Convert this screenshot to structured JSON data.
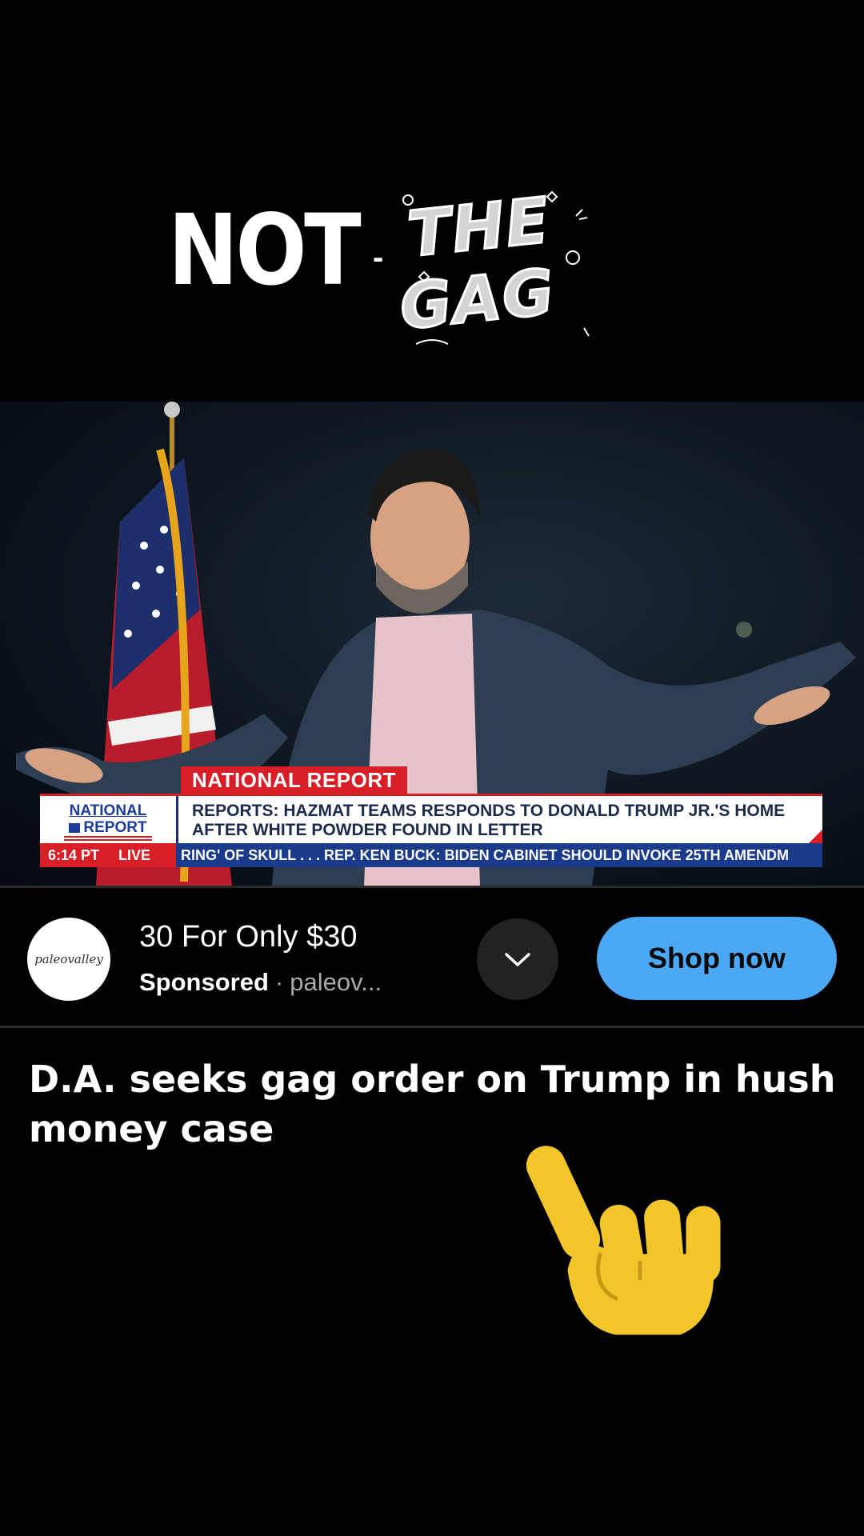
{
  "logo": {
    "word1": "NOT",
    "dash": "-",
    "word2": "THE",
    "word3": "GAG"
  },
  "video": {
    "lower_third": {
      "tab": "NATIONAL REPORT",
      "brand_line1": "NATIONAL",
      "brand_line2": "REPORT",
      "headline": "REPORTS: HAZMAT TEAMS RESPONDS TO DONALD TRUMP JR.'S HOME AFTER WHITE POWDER FOUND IN LETTER",
      "time": "6:14 PT",
      "live": "LIVE",
      "ticker": "RING' OF SKULL . . .      REP. KEN BUCK: BIDEN CABINET SHOULD INVOKE 25TH AMENDM"
    }
  },
  "ad": {
    "avatar_text": "paleovalley",
    "title": "30 For Only $30",
    "sponsored": "Sponsored",
    "separator": "·",
    "domain": "paleov...",
    "cta": "Shop now",
    "chevron_icon": "chevron-down-icon",
    "cta_color": "#4aa8f5"
  },
  "post": {
    "headline": "D.A. seeks gag order on Trump in hush money case",
    "emoji_icon": "index-pointing-up-emoji",
    "emoji_color": "#f2c62b"
  }
}
